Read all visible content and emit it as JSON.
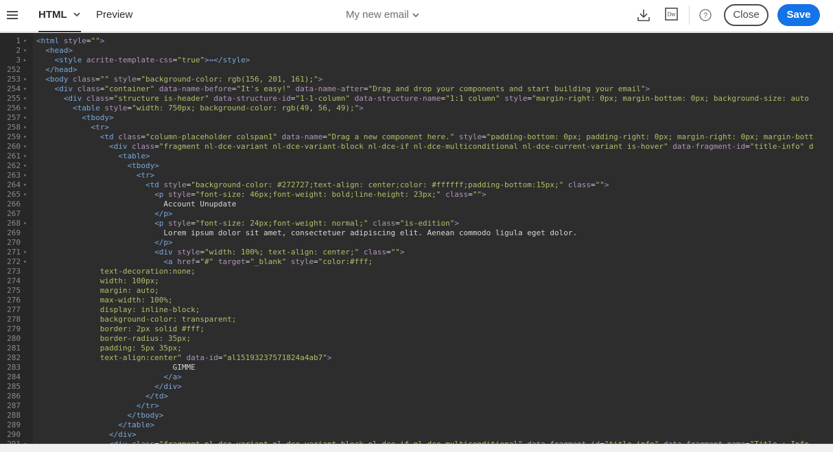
{
  "header": {
    "tab_html": "HTML",
    "tab_preview": "Preview",
    "email_title": "My new email",
    "close_label": "Close",
    "save_label": "Save",
    "dw_label": "Dw",
    "help_label": "?"
  },
  "colors": {
    "accent": "#1473e6"
  },
  "icons": [
    "menu-icon",
    "chevron-down-icon",
    "download-icon",
    "dreamweaver-icon",
    "help-icon"
  ],
  "code_lines": [
    {
      "ln": "1",
      "fold": "▾",
      "tokens": [
        [
          "t",
          "<html "
        ],
        [
          "a",
          "style"
        ],
        [
          "p",
          "="
        ],
        [
          "s",
          "\"\""
        ],
        [
          "t",
          ">"
        ]
      ]
    },
    {
      "ln": "2",
      "fold": "▾",
      "tokens": [
        [
          "p",
          "  "
        ],
        [
          "t",
          "<head>"
        ]
      ]
    },
    {
      "ln": "3",
      "fold": "▸",
      "tokens": [
        [
          "p",
          "    "
        ],
        [
          "t",
          "<style "
        ],
        [
          "a",
          "acrite-template-css"
        ],
        [
          "p",
          "="
        ],
        [
          "s",
          "\"true\""
        ],
        [
          "t",
          ">"
        ],
        [
          "fm",
          "↔"
        ],
        [
          "t",
          "</style>"
        ]
      ]
    },
    {
      "ln": "252",
      "fold": "",
      "tokens": [
        [
          "p",
          "  "
        ],
        [
          "t",
          "</head>"
        ]
      ]
    },
    {
      "ln": "253",
      "fold": "▾",
      "tokens": [
        [
          "p",
          "  "
        ],
        [
          "t",
          "<body "
        ],
        [
          "a",
          "class"
        ],
        [
          "p",
          "="
        ],
        [
          "s",
          "\"\" "
        ],
        [
          "a",
          "style"
        ],
        [
          "p",
          "="
        ],
        [
          "s",
          "\"background-color: rgb(156, 201, 161);\""
        ],
        [
          "t",
          ">"
        ]
      ]
    },
    {
      "ln": "254",
      "fold": "▾",
      "tokens": [
        [
          "p",
          "    "
        ],
        [
          "t",
          "<div "
        ],
        [
          "a",
          "class"
        ],
        [
          "p",
          "="
        ],
        [
          "s",
          "\"container\" "
        ],
        [
          "a",
          "data-name-before"
        ],
        [
          "p",
          "="
        ],
        [
          "s",
          "\"It's easy!\" "
        ],
        [
          "a",
          "data-name-after"
        ],
        [
          "p",
          "="
        ],
        [
          "s",
          "\"Drag and drop your components and start building your email\""
        ],
        [
          "t",
          ">"
        ]
      ]
    },
    {
      "ln": "255",
      "fold": "▾",
      "tokens": [
        [
          "p",
          "      "
        ],
        [
          "t",
          "<div "
        ],
        [
          "a",
          "class"
        ],
        [
          "p",
          "="
        ],
        [
          "s",
          "\"structure is-header\" "
        ],
        [
          "a",
          "data-structure-id"
        ],
        [
          "p",
          "="
        ],
        [
          "s",
          "\"1-1-column\" "
        ],
        [
          "a",
          "data-structure-name"
        ],
        [
          "p",
          "="
        ],
        [
          "s",
          "\"1:1 column\" "
        ],
        [
          "a",
          "style"
        ],
        [
          "p",
          "="
        ],
        [
          "s",
          "\"margin-right: 0px; margin-bottom: 0px; background-size: auto"
        ]
      ]
    },
    {
      "ln": "256",
      "fold": "▾",
      "tokens": [
        [
          "p",
          "        "
        ],
        [
          "t",
          "<table "
        ],
        [
          "a",
          "style"
        ],
        [
          "p",
          "="
        ],
        [
          "s",
          "\"width: 750px; background-color: rgb(49, 56, 49);\""
        ],
        [
          "t",
          ">"
        ]
      ]
    },
    {
      "ln": "257",
      "fold": "▾",
      "tokens": [
        [
          "p",
          "          "
        ],
        [
          "t",
          "<tbody>"
        ]
      ]
    },
    {
      "ln": "258",
      "fold": "▾",
      "tokens": [
        [
          "p",
          "            "
        ],
        [
          "t",
          "<tr>"
        ]
      ]
    },
    {
      "ln": "259",
      "fold": "▾",
      "tokens": [
        [
          "p",
          "              "
        ],
        [
          "t",
          "<td "
        ],
        [
          "a",
          "class"
        ],
        [
          "p",
          "="
        ],
        [
          "s",
          "\"column-placeholder colspan1\" "
        ],
        [
          "a",
          "data-name"
        ],
        [
          "p",
          "="
        ],
        [
          "s",
          "\"Drag a new component here.\" "
        ],
        [
          "a",
          "style"
        ],
        [
          "p",
          "="
        ],
        [
          "s",
          "\"padding-bottom: 0px; padding-right: 0px; margin-right: 0px; margin-bott"
        ]
      ]
    },
    {
      "ln": "260",
      "fold": "▾",
      "tokens": [
        [
          "p",
          "                "
        ],
        [
          "t",
          "<div "
        ],
        [
          "a",
          "class"
        ],
        [
          "p",
          "="
        ],
        [
          "s",
          "\"fragment nl-dce-variant nl-dce-variant-block nl-dce-if nl-dce-multiconditional nl-dce-current-variant is-hover\" "
        ],
        [
          "a",
          "data-fragment-id"
        ],
        [
          "p",
          "="
        ],
        [
          "s",
          "\"title-info\" d"
        ]
      ]
    },
    {
      "ln": "261",
      "fold": "▾",
      "tokens": [
        [
          "p",
          "                  "
        ],
        [
          "t",
          "<table>"
        ]
      ]
    },
    {
      "ln": "262",
      "fold": "▾",
      "tokens": [
        [
          "p",
          "                    "
        ],
        [
          "t",
          "<tbody>"
        ]
      ]
    },
    {
      "ln": "263",
      "fold": "▾",
      "tokens": [
        [
          "p",
          "                      "
        ],
        [
          "t",
          "<tr>"
        ]
      ]
    },
    {
      "ln": "264",
      "fold": "▾",
      "tokens": [
        [
          "p",
          "                        "
        ],
        [
          "t",
          "<td "
        ],
        [
          "a",
          "style"
        ],
        [
          "p",
          "="
        ],
        [
          "s",
          "\"background-color: #272727;text-align: center;color: #ffffff;padding-bottom:15px;\" "
        ],
        [
          "a",
          "class"
        ],
        [
          "p",
          "="
        ],
        [
          "s",
          "\"\""
        ],
        [
          "t",
          ">"
        ]
      ]
    },
    {
      "ln": "265",
      "fold": "▾",
      "tokens": [
        [
          "p",
          "                          "
        ],
        [
          "t",
          "<p "
        ],
        [
          "a",
          "style"
        ],
        [
          "p",
          "="
        ],
        [
          "s",
          "\"font-size: 46px;font-weight: bold;line-height: 23px;\" "
        ],
        [
          "a",
          "class"
        ],
        [
          "p",
          "="
        ],
        [
          "s",
          "\"\""
        ],
        [
          "t",
          ">"
        ]
      ]
    },
    {
      "ln": "266",
      "fold": "",
      "tokens": [
        [
          "p",
          "                            Account Unupdate"
        ]
      ]
    },
    {
      "ln": "267",
      "fold": "",
      "tokens": [
        [
          "p",
          "                          "
        ],
        [
          "t",
          "</p>"
        ]
      ]
    },
    {
      "ln": "268",
      "fold": "▾",
      "tokens": [
        [
          "p",
          "                          "
        ],
        [
          "t",
          "<p "
        ],
        [
          "a",
          "style"
        ],
        [
          "p",
          "="
        ],
        [
          "s",
          "\"font-size: 24px;font-weight: normal;\" "
        ],
        [
          "a",
          "class"
        ],
        [
          "p",
          "="
        ],
        [
          "s",
          "\"is-edition\""
        ],
        [
          "t",
          ">"
        ]
      ]
    },
    {
      "ln": "269",
      "fold": "",
      "tokens": [
        [
          "p",
          "                            Lorem ipsum dolor sit amet, consectetuer adipiscing elit. Aenean commodo ligula eget dolor."
        ]
      ]
    },
    {
      "ln": "270",
      "fold": "",
      "tokens": [
        [
          "p",
          "                          "
        ],
        [
          "t",
          "</p>"
        ]
      ]
    },
    {
      "ln": "271",
      "fold": "▾",
      "tokens": [
        [
          "p",
          "                          "
        ],
        [
          "t",
          "<div "
        ],
        [
          "a",
          "style"
        ],
        [
          "p",
          "="
        ],
        [
          "s",
          "\"width: 100%; text-align: center;\" "
        ],
        [
          "a",
          "class"
        ],
        [
          "p",
          "="
        ],
        [
          "s",
          "\"\""
        ],
        [
          "t",
          ">"
        ]
      ]
    },
    {
      "ln": "272",
      "fold": "▾",
      "tokens": [
        [
          "p",
          "                            "
        ],
        [
          "t",
          "<a "
        ],
        [
          "a",
          "href"
        ],
        [
          "p",
          "="
        ],
        [
          "s",
          "\"#\" "
        ],
        [
          "a",
          "target"
        ],
        [
          "p",
          "="
        ],
        [
          "s",
          "\"_blank\" "
        ],
        [
          "a",
          "style"
        ],
        [
          "p",
          "="
        ],
        [
          "s",
          "\"color:#fff;"
        ]
      ]
    },
    {
      "ln": "273",
      "fold": "",
      "tokens": [
        [
          "s",
          "              text-decoration:none;"
        ]
      ]
    },
    {
      "ln": "274",
      "fold": "",
      "tokens": [
        [
          "s",
          "              width: 100px;"
        ]
      ]
    },
    {
      "ln": "275",
      "fold": "",
      "tokens": [
        [
          "s",
          "              margin: auto;"
        ]
      ]
    },
    {
      "ln": "276",
      "fold": "",
      "tokens": [
        [
          "s",
          "              max-width: 100%;"
        ]
      ]
    },
    {
      "ln": "277",
      "fold": "",
      "tokens": [
        [
          "s",
          "              display: inline-block;"
        ]
      ]
    },
    {
      "ln": "278",
      "fold": "",
      "tokens": [
        [
          "s",
          "              background-color: transparent;"
        ]
      ]
    },
    {
      "ln": "279",
      "fold": "",
      "tokens": [
        [
          "s",
          "              border: 2px solid #fff;"
        ]
      ]
    },
    {
      "ln": "280",
      "fold": "",
      "tokens": [
        [
          "s",
          "              border-radius: 35px;"
        ]
      ]
    },
    {
      "ln": "281",
      "fold": "",
      "tokens": [
        [
          "s",
          "              padding: 5px 35px;"
        ]
      ]
    },
    {
      "ln": "282",
      "fold": "",
      "tokens": [
        [
          "s",
          "              text-align:center\" "
        ],
        [
          "a",
          "data-id"
        ],
        [
          "p",
          "="
        ],
        [
          "s",
          "\"al15193237571824a4ab7\""
        ],
        [
          "t",
          ">"
        ]
      ]
    },
    {
      "ln": "283",
      "fold": "",
      "tokens": [
        [
          "p",
          "                              GIMME"
        ]
      ]
    },
    {
      "ln": "284",
      "fold": "",
      "tokens": [
        [
          "p",
          "                            "
        ],
        [
          "t",
          "</a>"
        ]
      ]
    },
    {
      "ln": "285",
      "fold": "",
      "tokens": [
        [
          "p",
          "                          "
        ],
        [
          "t",
          "</div>"
        ]
      ]
    },
    {
      "ln": "286",
      "fold": "",
      "tokens": [
        [
          "p",
          "                        "
        ],
        [
          "t",
          "</td>"
        ]
      ]
    },
    {
      "ln": "287",
      "fold": "",
      "tokens": [
        [
          "p",
          "                      "
        ],
        [
          "t",
          "</tr>"
        ]
      ]
    },
    {
      "ln": "288",
      "fold": "",
      "tokens": [
        [
          "p",
          "                    "
        ],
        [
          "t",
          "</tbody>"
        ]
      ]
    },
    {
      "ln": "289",
      "fold": "",
      "tokens": [
        [
          "p",
          "                  "
        ],
        [
          "t",
          "</table>"
        ]
      ]
    },
    {
      "ln": "290",
      "fold": "",
      "tokens": [
        [
          "p",
          "                "
        ],
        [
          "t",
          "</div>"
        ]
      ]
    },
    {
      "ln": "291",
      "fold": "▾",
      "tokens": [
        [
          "p",
          "                "
        ],
        [
          "t",
          "<div "
        ],
        [
          "a",
          "class"
        ],
        [
          "p",
          "="
        ],
        [
          "s",
          "\"fragment nl-dce-variant nl-dce-variant-block nl-dce-if nl-dce-multiconditional\" "
        ],
        [
          "a",
          "data-fragment-id"
        ],
        [
          "p",
          "="
        ],
        [
          "s",
          "\"title-info\" "
        ],
        [
          "a",
          "data-fragment-name"
        ],
        [
          "p",
          "="
        ],
        [
          "s",
          "\"Title + Info"
        ]
      ]
    }
  ]
}
